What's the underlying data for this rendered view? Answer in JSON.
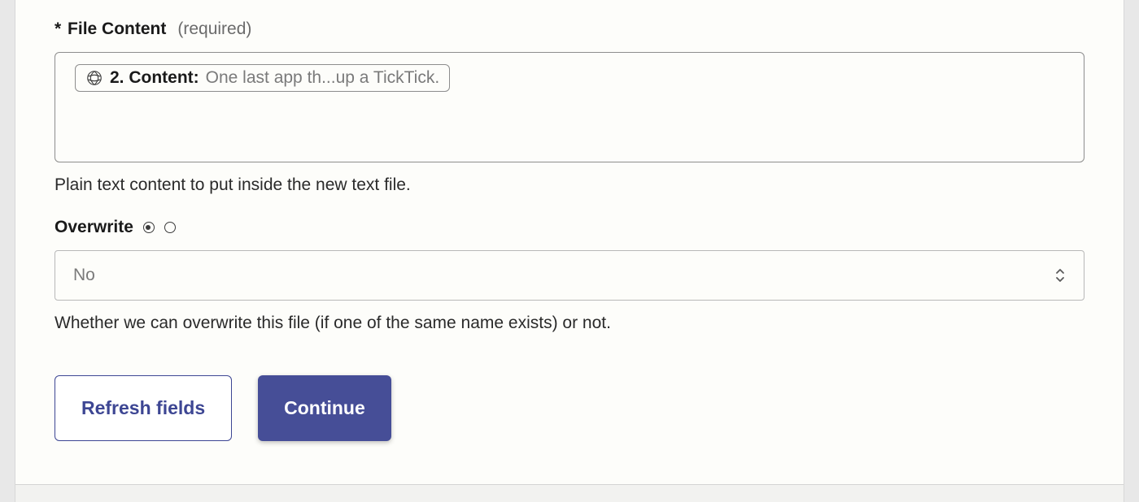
{
  "file_content": {
    "asterisk": "*",
    "label": "File Content",
    "required": "(required)",
    "pill": {
      "icon_name": "openai-icon",
      "label": "2. Content:",
      "value": "One last app th...up a TickTick."
    },
    "help": "Plain text content to put inside the new text file."
  },
  "overwrite": {
    "label": "Overwrite",
    "selected_value": "No",
    "help": "Whether we can overwrite this file (if one of the same name exists) or not."
  },
  "buttons": {
    "refresh": "Refresh fields",
    "continue": "Continue"
  }
}
